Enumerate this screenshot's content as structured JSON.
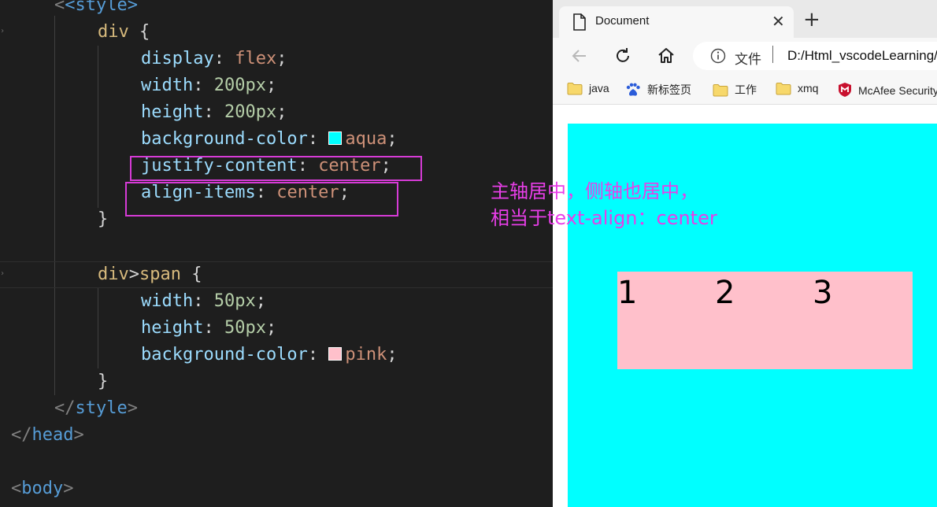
{
  "editor": {
    "lines": {
      "style_open": "<style>",
      "div_selector": "div",
      "display_prop": "display",
      "display_val": "flex",
      "width_prop": "width",
      "width_val": "200px",
      "height_prop": "height",
      "height_val": "200px",
      "bg_prop": "background-color",
      "bg_val": "aqua",
      "justify_prop": "justify-content",
      "justify_val": "center",
      "align_prop": "align-items",
      "align_val": "center",
      "span_selector_a": "div",
      "span_selector_b": "span",
      "span_width_prop": "width",
      "span_width_val": "50px",
      "span_height_prop": "height",
      "span_height_val": "50px",
      "span_bg_prop": "background-color",
      "span_bg_val": "pink",
      "style_close": "style",
      "head_close": "head",
      "body_open": "body"
    },
    "swatches": {
      "aqua": "#00ffff",
      "pink": "#ffc0cb"
    }
  },
  "annotation": {
    "line1": "主轴居中，侧轴也居中，",
    "line2": "相当于text-align：center",
    "color": "#e83ee8"
  },
  "browser": {
    "tab_title": "Document",
    "address_label": "文件",
    "address_url": "D:/Html_vscodeLearning/",
    "favorites": [
      "java",
      "新标签页",
      "工作",
      "xmq",
      "McAfee Security"
    ],
    "page": {
      "container_color": "#00ffff",
      "span_color": "#ffc0cb",
      "items": [
        "1",
        "2",
        "3"
      ]
    }
  }
}
